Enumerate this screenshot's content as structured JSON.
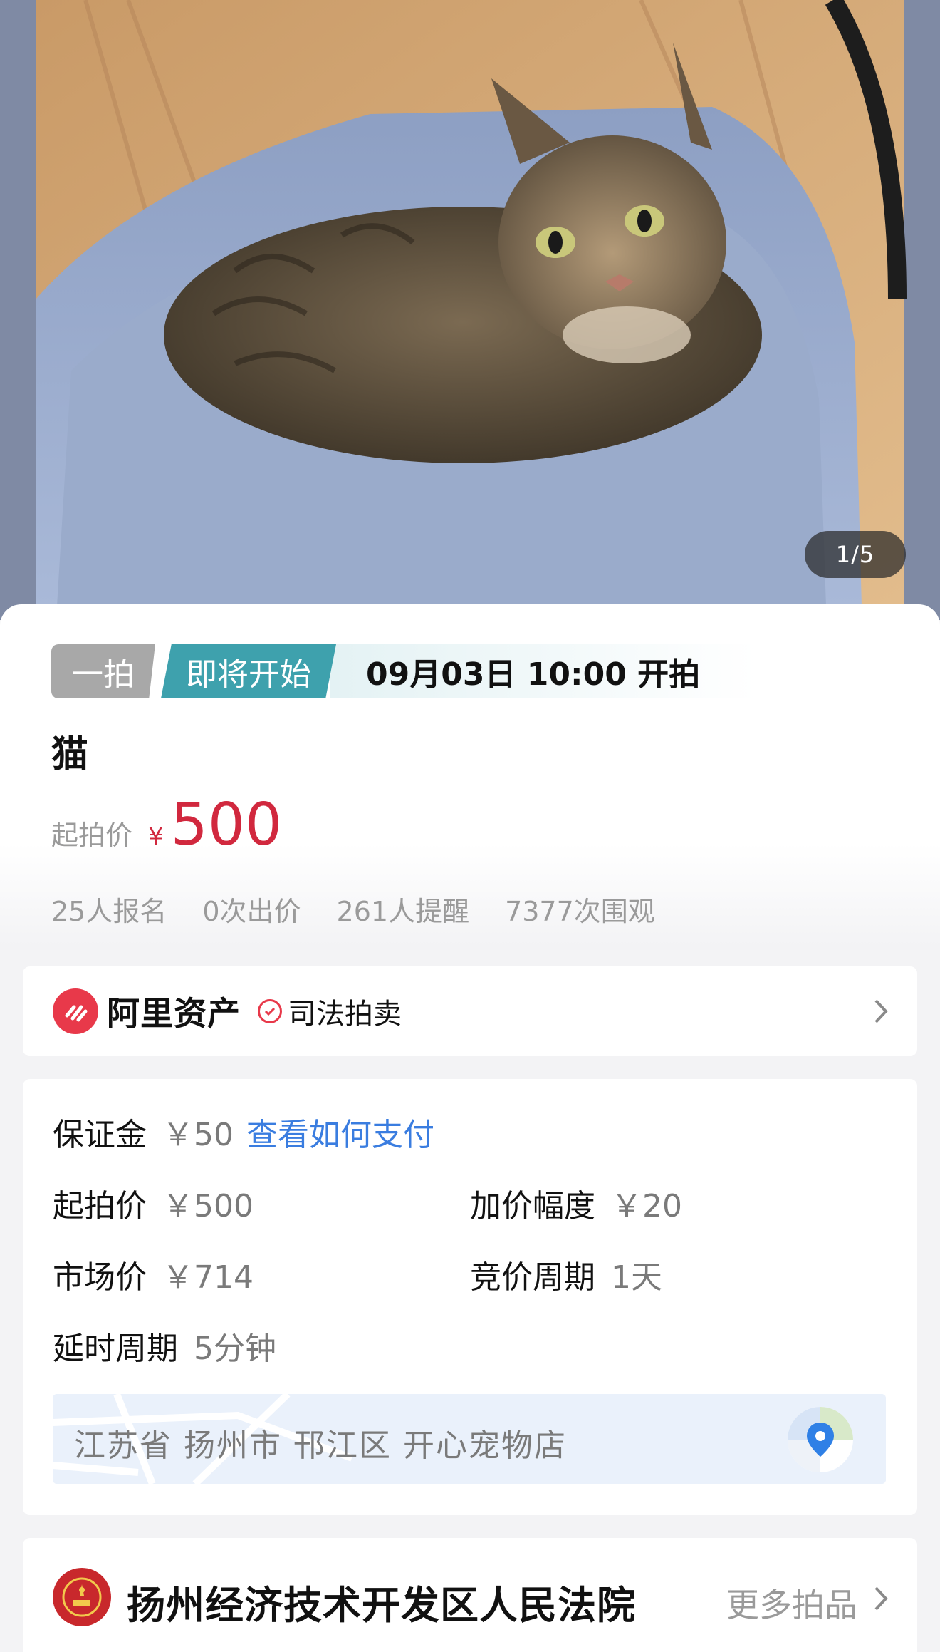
{
  "gallery": {
    "indicator": "1/5"
  },
  "status": {
    "type_tag": "一拍",
    "state_tag": "即将开始",
    "start_time": "09月03日 10:00 开拍"
  },
  "item": {
    "title": "猫"
  },
  "price": {
    "label": "起拍价",
    "currency": "¥",
    "value": "500"
  },
  "stats": [
    "25人报名",
    "0次出价",
    "261人提醒",
    "7377次围观"
  ],
  "platform": {
    "name": "阿里资产",
    "badge": "司法拍卖"
  },
  "info": {
    "deposit_label": "保证金",
    "deposit_value": "￥50",
    "deposit_link": "查看如何支付",
    "start_label": "起拍价",
    "start_value": "￥500",
    "increment_label": "加价幅度",
    "increment_value": "￥20",
    "market_label": "市场价",
    "market_value": "￥714",
    "cycle_label": "竞价周期",
    "cycle_value": "1天",
    "delay_label": "延时周期",
    "delay_value": "5分钟",
    "address": "江苏省 扬州市 邗江区 开心宠物店"
  },
  "court": {
    "name": "扬州经济技术开发区人民法院",
    "more": "更多拍品"
  },
  "colors": {
    "accent_red": "#d1283e",
    "tag_teal": "#3ea1ad",
    "link_blue": "#3a7de0",
    "brand_red": "#e8394a"
  },
  "icons": [
    "chevron-right-icon",
    "check-circle-icon",
    "map-pin-icon",
    "court-emblem-icon",
    "ali-logo-icon"
  ]
}
